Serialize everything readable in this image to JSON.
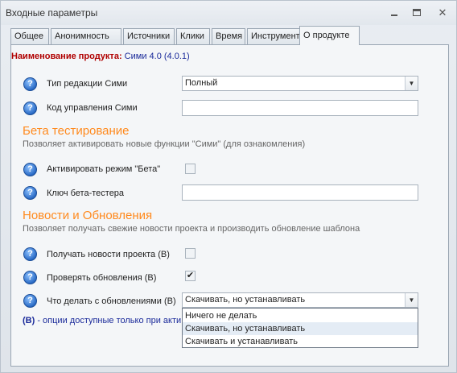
{
  "window": {
    "title": "Входные параметры"
  },
  "tabs": [
    {
      "label": "Общее"
    },
    {
      "label": "Анонимность"
    },
    {
      "label": "Источники"
    },
    {
      "label": "Клики"
    },
    {
      "label": "Время"
    },
    {
      "label": "Инструменты"
    },
    {
      "label": "О продукте",
      "active": true
    }
  ],
  "product": {
    "label": "Наименование продукта:",
    "value": "Сими 4.0 (4.0.1)"
  },
  "fields": {
    "edition_label": "Тип редакции Сими",
    "edition_value": "Полный",
    "control_code_label": "Код управления Сими",
    "control_code_value": ""
  },
  "beta": {
    "title": "Бета тестирование",
    "description": "Позволяет активировать новые функции \"Сими\" (для ознакомления)",
    "enable_label": "Активировать режим \"Бета\"",
    "enable_checked": false,
    "key_label": "Ключ бета-тестера",
    "key_value": ""
  },
  "news": {
    "title": "Новости и Обновления",
    "description": "Позволяет получать свежие новости  проекта и производить обновление шаблона",
    "get_news_label": "Получать новости проекта (B)",
    "get_news_checked": false,
    "check_updates_label": "Проверять обновления (B)",
    "check_updates_checked": true,
    "action_label": "Что делать с обновлениями (B)",
    "action_value": "Скачивать, но устанавливать",
    "options": [
      "Ничего не делать",
      "Скачивать, но устанавливать",
      "Скачивать и устанавливать"
    ]
  },
  "footnote": {
    "marker": "(B)",
    "text": " - опции доступные только при акти"
  },
  "colors": {
    "accent_orange": "#ff8a1e",
    "product_label_red": "#b00000",
    "footnote_blue": "#1a2a9a"
  },
  "icons": {
    "help": "question-mark-circle",
    "dropdown": "triangle-down",
    "check": "check-mark"
  }
}
